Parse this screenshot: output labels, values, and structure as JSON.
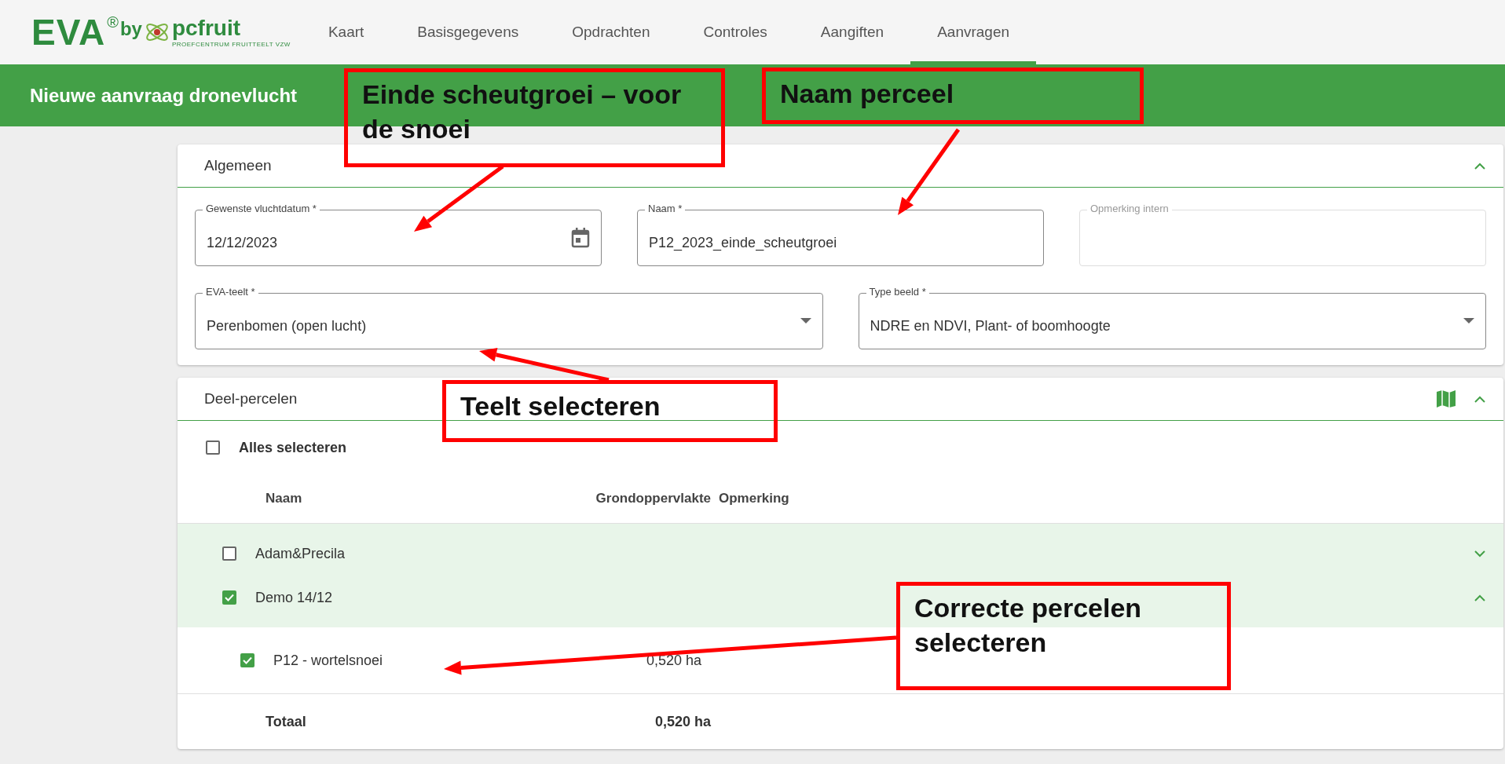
{
  "header": {
    "logo": {
      "brand": "EVA",
      "reg": "®",
      "by": "by",
      "name": "pcfruit",
      "tagline": "PROEFCENTRUM FRUITTEELT VZW"
    },
    "nav": [
      {
        "label": "Kaart",
        "selected": false
      },
      {
        "label": "Basisgegevens",
        "selected": false
      },
      {
        "label": "Opdrachten",
        "selected": false
      },
      {
        "label": "Controles",
        "selected": false
      },
      {
        "label": "Aangiften",
        "selected": false
      },
      {
        "label": "Aanvragen",
        "selected": true
      }
    ]
  },
  "page_title": "Nieuwe aanvraag dronevlucht",
  "general": {
    "title": "Algemeen",
    "expanded": true,
    "fields": [
      {
        "kind": "date",
        "label": "Gewenste vluchtdatum *",
        "value": "12/12/2023",
        "disabled": false
      },
      {
        "kind": "text",
        "label": "Naam *",
        "value": "P12_2023_einde_scheutgroei",
        "disabled": false
      },
      {
        "kind": "text",
        "label": "Opmerking intern",
        "disabled": true
      }
    ],
    "selects": [
      {
        "label": "EVA-teelt *",
        "value": "Perenbomen (open lucht)"
      },
      {
        "label": "Type beeld *",
        "value": "NDRE en NDVI, Plant- of boomhoogte"
      }
    ]
  },
  "parcels": {
    "title": "Deel-percelen",
    "expanded": true,
    "select_all": {
      "label": "Alles selecteren",
      "checked": false
    },
    "columns": [
      "Naam",
      "Grondoppervlakte",
      "Opmerking"
    ],
    "groups": [
      {
        "name": "Adam&Precila",
        "checked": false,
        "expanded": false
      },
      {
        "name": "Demo 14/12",
        "checked": true,
        "expanded": true,
        "children": [
          {
            "name": "P12 - wortelsnoei",
            "checked": true,
            "area": "0,520 ha"
          }
        ]
      }
    ],
    "total": {
      "label": "Totaal",
      "area": "0,520 ha"
    }
  },
  "annotations": [
    {
      "text": "Einde scheutgroei – voor de snoei"
    },
    {
      "text": "Naam perceel"
    },
    {
      "text": "Teelt selecteren"
    },
    {
      "text": "Correcte percelen selecteren"
    }
  ]
}
